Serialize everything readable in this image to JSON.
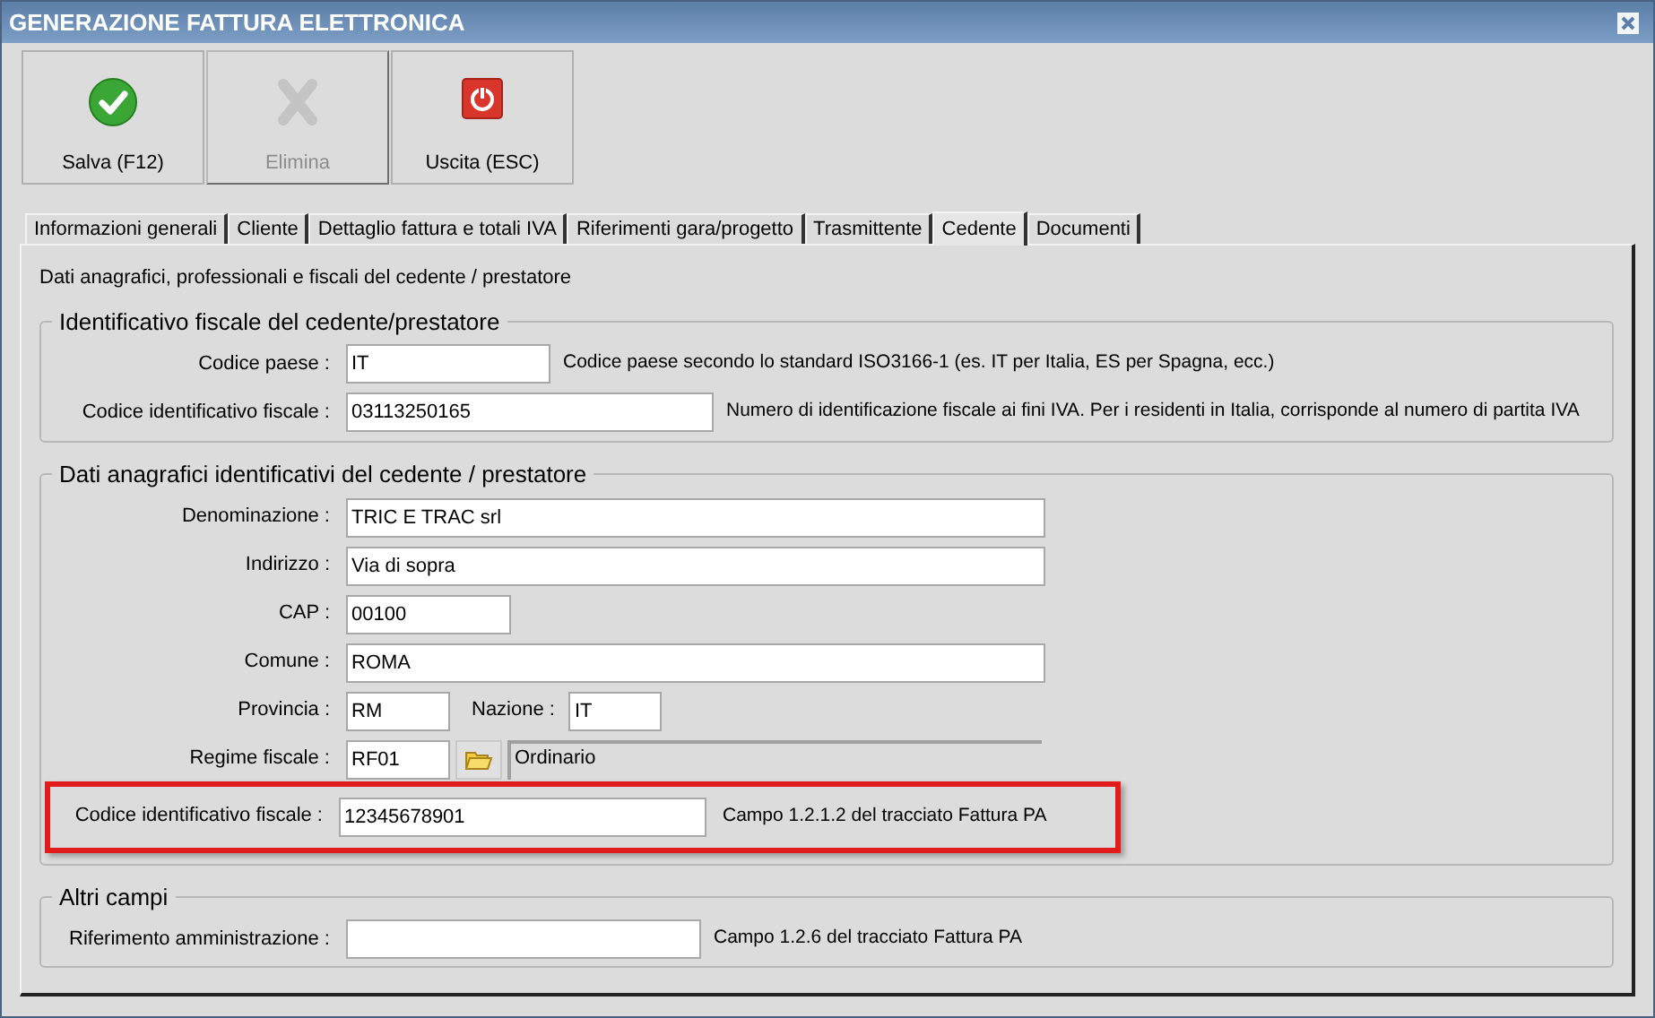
{
  "window": {
    "title": "GENERAZIONE FATTURA ELETTRONICA"
  },
  "toolbar": [
    {
      "kind": "save",
      "label": "Salva (F12)",
      "disabled": false
    },
    {
      "kind": "delete",
      "label": "Elimina",
      "disabled": true
    },
    {
      "kind": "exit",
      "label": "Uscita (ESC)",
      "disabled": false
    }
  ],
  "tabs": [
    {
      "label": "Informazioni generali",
      "selected": false
    },
    {
      "label": "Cliente",
      "selected": false
    },
    {
      "label": "Dettaglio fattura e totali IVA",
      "selected": false
    },
    {
      "label": "Riferimenti gara/progetto",
      "selected": false
    },
    {
      "label": "Trasmittente",
      "selected": false
    },
    {
      "label": "Cedente",
      "selected": true
    },
    {
      "label": "Documenti",
      "selected": false
    }
  ],
  "panel": {
    "description": "Dati anagrafici, professionali e fiscali del cedente / prestatore",
    "groups": [
      {
        "title": "Identificativo fiscale del cedente/prestatore",
        "rows": [
          {
            "fields": [
              {
                "label": "Codice paese :",
                "value": "IT"
              }
            ],
            "note": "Codice paese secondo lo standard ISO3166-1 (es. IT per Italia, ES per Spagna, ecc.)",
            "highlighted": false
          },
          {
            "fields": [
              {
                "label": "Codice identificativo fiscale :",
                "value": "03113250165"
              }
            ],
            "note": "Numero di identificazione fiscale ai fini IVA. Per i residenti in Italia, corrisponde al numero di partita IVA",
            "highlighted": false
          }
        ]
      },
      {
        "title": "Dati anagrafici identificativi del cedente / prestatore",
        "rows": [
          {
            "fields": [
              {
                "label": "Denominazione :",
                "value": "TRIC E TRAC srl"
              }
            ],
            "highlighted": false
          },
          {
            "fields": [
              {
                "label": "Indirizzo :",
                "value": "Via di sopra"
              }
            ],
            "highlighted": false
          },
          {
            "fields": [
              {
                "label": "CAP :",
                "value": "00100"
              }
            ],
            "highlighted": false
          },
          {
            "fields": [
              {
                "label": "Comune :",
                "value": "ROMA"
              }
            ],
            "highlighted": false
          },
          {
            "fields": [
              {
                "label": "Provincia :",
                "value": "RM"
              },
              {
                "label": "Nazione :",
                "value": "IT"
              }
            ],
            "highlighted": false
          },
          {
            "fields": [
              {
                "label": "Regime fiscale :",
                "value": "RF01"
              }
            ],
            "lookup": {
              "description": "Ordinario"
            },
            "highlighted": false
          },
          {
            "fields": [
              {
                "label": "Codice identificativo fiscale :",
                "value": "12345678901"
              }
            ],
            "note": "Campo 1.2.1.2 del tracciato Fattura PA",
            "highlighted": true
          }
        ]
      },
      {
        "title": "Altri campi",
        "rows": [
          {
            "fields": [
              {
                "label": "Riferimento amministrazione :"
              }
            ],
            "note": "Campo 1.2.6 del tracciato Fattura PA",
            "highlighted": false
          }
        ]
      }
    ]
  }
}
